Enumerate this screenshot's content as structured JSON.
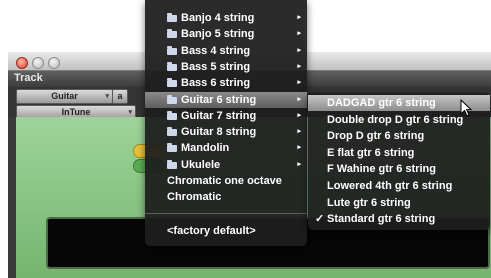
{
  "window": {
    "section_label": "Track",
    "controls": {
      "instrument_value": "Guitar",
      "key_value": "a",
      "preset_value": "InTune"
    }
  },
  "menu": {
    "items": [
      {
        "label": "Banjo 4 string",
        "folder": true,
        "submenu": true
      },
      {
        "label": "Banjo 5 string",
        "folder": true,
        "submenu": true
      },
      {
        "label": "Bass 4 string",
        "folder": true,
        "submenu": true
      },
      {
        "label": "Bass 5 string",
        "folder": true,
        "submenu": true
      },
      {
        "label": "Bass 6 string",
        "folder": true,
        "submenu": true
      },
      {
        "label": "Guitar 6 string",
        "folder": true,
        "submenu": true,
        "highlighted": true
      },
      {
        "label": "Guitar 7 string",
        "folder": true,
        "submenu": true
      },
      {
        "label": "Guitar 8 string",
        "folder": true,
        "submenu": true
      },
      {
        "label": "Mandolin",
        "folder": true,
        "submenu": true
      },
      {
        "label": "Ukulele",
        "folder": true,
        "submenu": true
      },
      {
        "label": "Chromatic one octave",
        "folder": false,
        "submenu": false
      },
      {
        "label": "Chromatic",
        "folder": false,
        "submenu": false
      }
    ],
    "footer_item": "<factory default>"
  },
  "submenu": {
    "items": [
      {
        "label": "DADGAD gtr 6 string",
        "highlighted": true
      },
      {
        "label": "Double drop D gtr 6 string"
      },
      {
        "label": "Drop D gtr 6 string"
      },
      {
        "label": "E flat gtr 6 string"
      },
      {
        "label": "F Wahine gtr 6 string"
      },
      {
        "label": "Lowered 4th gtr 6 string"
      },
      {
        "label": "Lute gtr 6 string"
      },
      {
        "label": "Standard gtr 6 string",
        "checked": true
      }
    ],
    "check_glyph": "✓"
  },
  "icons": {
    "folder": "folder-icon",
    "submenu_arrow": "▸",
    "dropdown_arrow": "▾"
  },
  "colors": {
    "menu_bg": "#1e1e1e",
    "highlight": "#8d8d8d",
    "plugin_green": "#8cc987"
  }
}
